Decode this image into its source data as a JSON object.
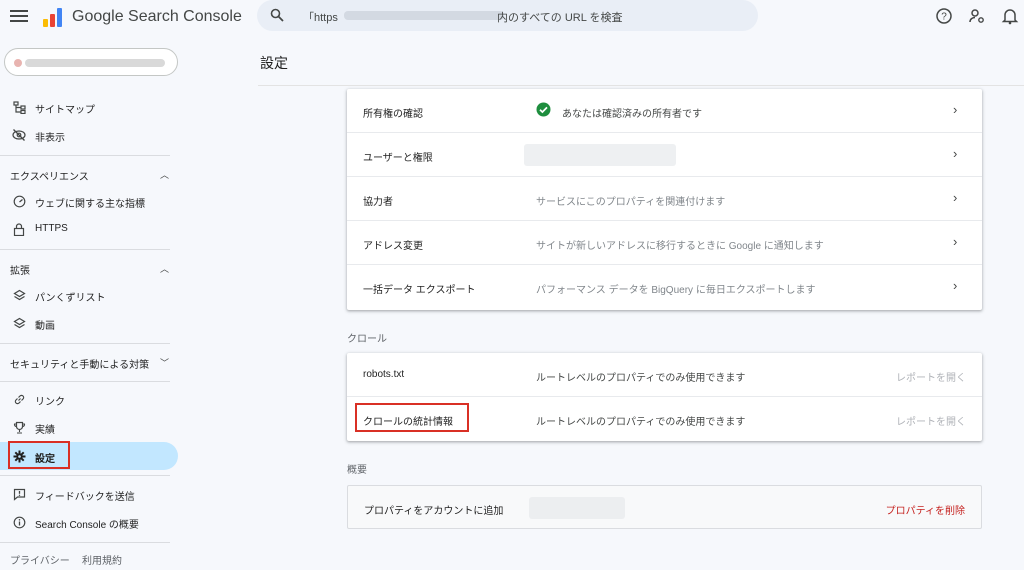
{
  "app": {
    "title": "Google Search Console"
  },
  "search": {
    "prefix": "「https",
    "suffix": "内のすべての URL を検査"
  },
  "sidebar": {
    "items": [
      {
        "label": "サイトマップ",
        "icon": "sitemap-icon"
      },
      {
        "label": "非表示",
        "icon": "eye-off-icon"
      }
    ],
    "sections": [
      {
        "label": "エクスペリエンス",
        "expanded": true,
        "items": [
          {
            "label": "ウェブに関する主な指標",
            "icon": "gauge-icon"
          },
          {
            "label": "HTTPS",
            "icon": "lock-icon"
          }
        ]
      },
      {
        "label": "拡張",
        "expanded": true,
        "items": [
          {
            "label": "パンくずリスト",
            "icon": "layers-icon"
          },
          {
            "label": "動画",
            "icon": "layers-icon"
          }
        ]
      },
      {
        "label": "セキュリティと手動による対策",
        "expanded": false,
        "items": []
      }
    ],
    "bottom_items": [
      {
        "label": "リンク",
        "icon": "link-icon"
      },
      {
        "label": "実績",
        "icon": "trophy-icon"
      },
      {
        "label": "設定",
        "icon": "gear-icon",
        "active": true
      },
      {
        "label": "フィードバックを送信",
        "icon": "feedback-icon"
      },
      {
        "label": "Search Console の概要",
        "icon": "info-icon"
      }
    ],
    "footer": [
      "プライバシー",
      "利用規約"
    ]
  },
  "main": {
    "title": "設定",
    "general_rows": [
      {
        "label": "所有権の確認",
        "desc": "あなたは確認済みの所有者です",
        "verified": true
      },
      {
        "label": "ユーザーと権限",
        "desc": ""
      },
      {
        "label": "協力者",
        "desc": "サービスにこのプロパティを関連付けます"
      },
      {
        "label": "アドレス変更",
        "desc": "サイトが新しいアドレスに移行するときに Google に通知します"
      },
      {
        "label": "一括データ エクスポート",
        "desc": "パフォーマンス データを BigQuery に毎日エクスポートします"
      }
    ],
    "crawl_caption": "クロール",
    "crawl_rows": [
      {
        "label": "robots.txt",
        "desc": "ルートレベルのプロパティでのみ使用できます",
        "action": "レポートを開く"
      },
      {
        "label": "クロールの統計情報",
        "desc": "ルートレベルのプロパティでのみ使用できます",
        "action": "レポートを開く"
      }
    ],
    "overview_caption": "概要",
    "overview_row": {
      "label": "プロパティをアカウントに追加",
      "action": "プロパティを削除"
    }
  },
  "colors": {
    "accent_active": "#c2e7ff",
    "verified": "#1e8e3e",
    "danger": "#c5221f",
    "highlight_box": "#d93025"
  }
}
